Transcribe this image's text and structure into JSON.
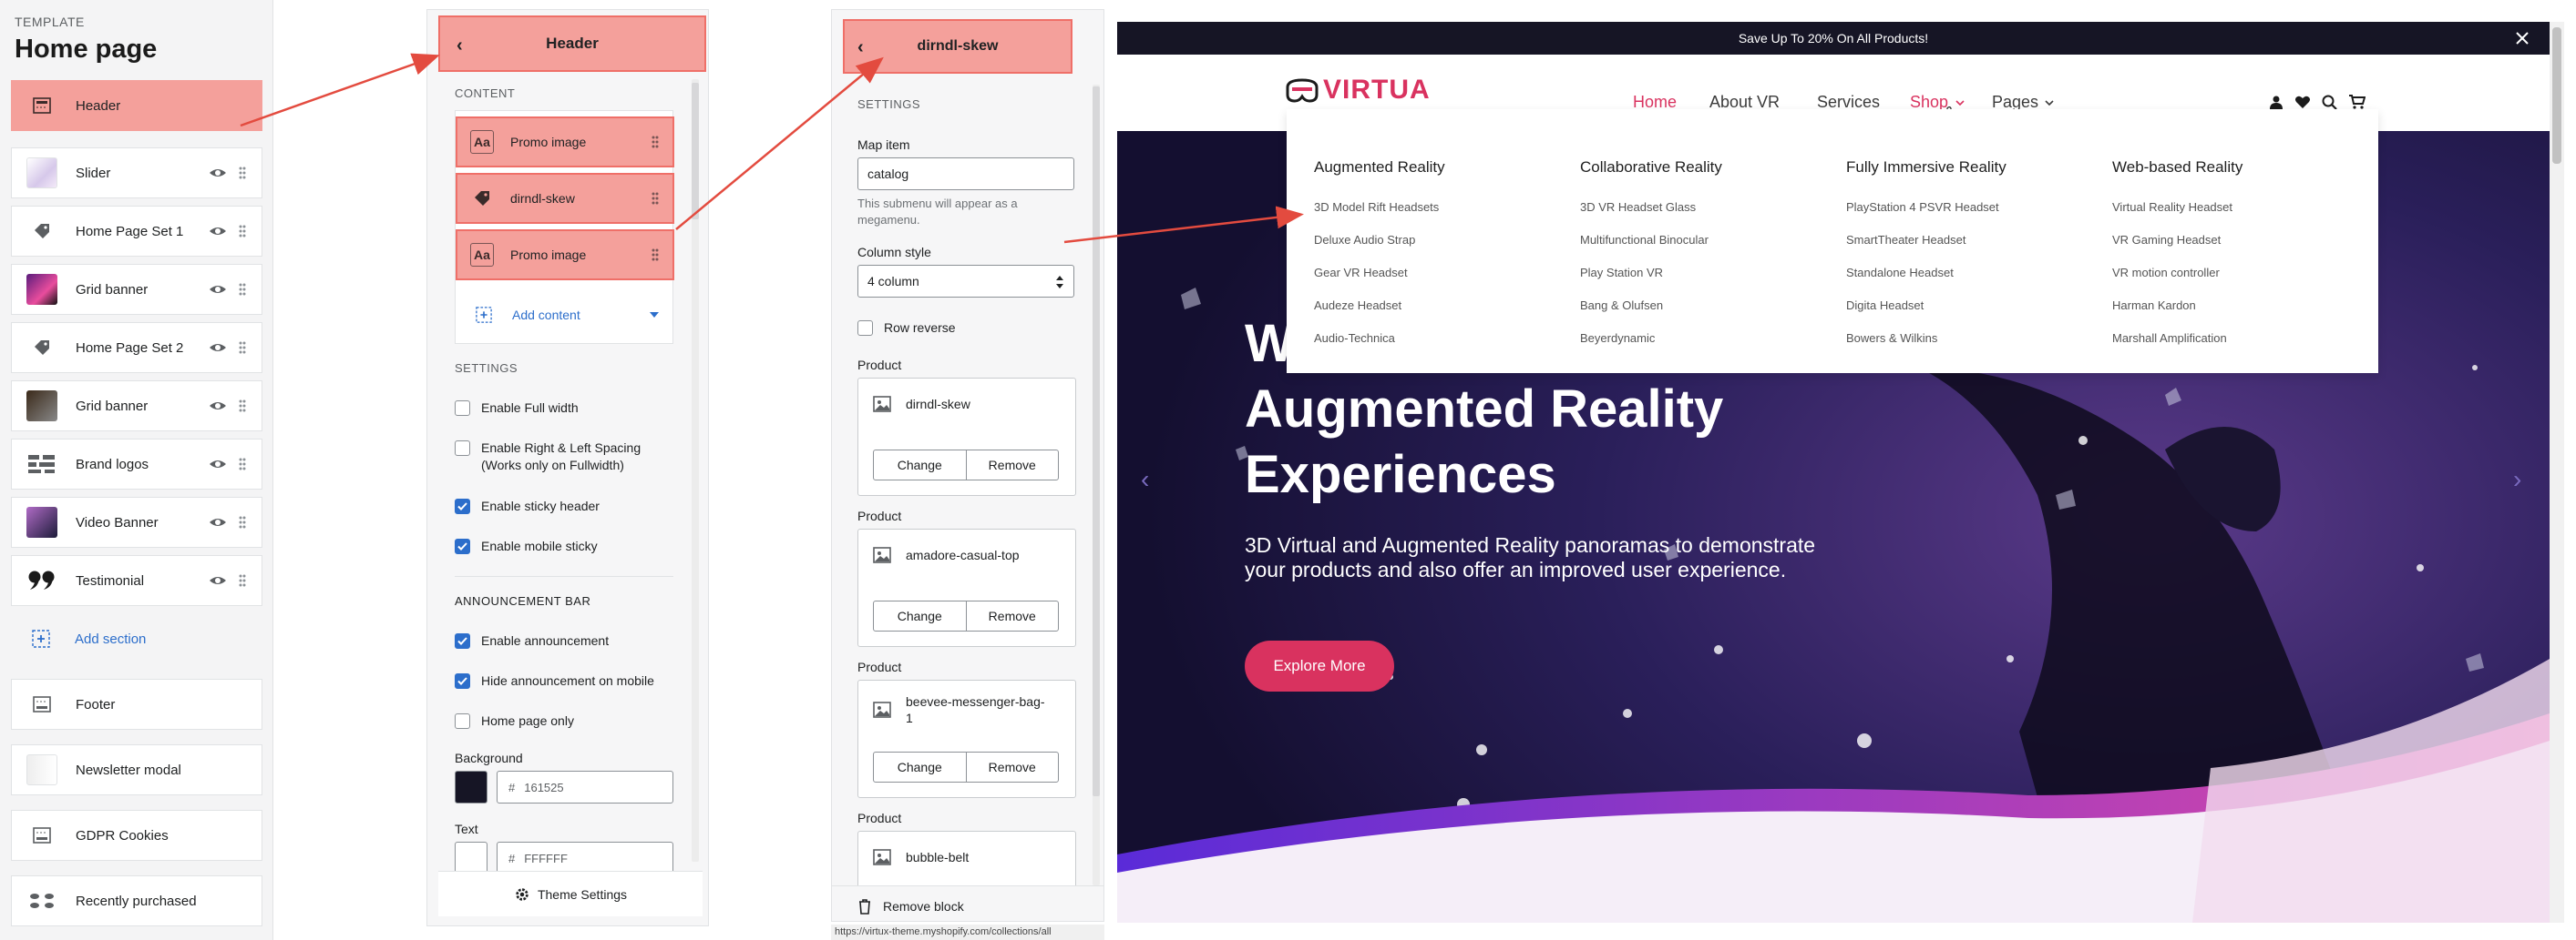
{
  "template_panel": {
    "kicker": "TEMPLATE",
    "title": "Home page",
    "sections": [
      {
        "label": "Header",
        "icon": "header-layout-icon"
      },
      {
        "label": "Slider",
        "icon": "slider-thumbnail"
      },
      {
        "label": "Home Page Set 1",
        "icon": "tag-icon"
      },
      {
        "label": "Grid banner",
        "icon": "grid-banner-thumbnail"
      },
      {
        "label": "Home Page Set 2",
        "icon": "tag-icon"
      },
      {
        "label": "Grid banner",
        "icon": "grid-banner-thumbnail"
      },
      {
        "label": "Brand logos",
        "icon": "brand-logos-thumbnail"
      },
      {
        "label": "Video Banner",
        "icon": "video-banner-thumbnail"
      },
      {
        "label": "Testimonial",
        "icon": "quote-icon"
      },
      {
        "label": "Add section",
        "icon": "add-section-icon"
      },
      {
        "label": "Footer",
        "icon": "footer-layout-icon"
      },
      {
        "label": "Newsletter modal",
        "icon": "newsletter-thumbnail"
      },
      {
        "label": "GDPR Cookies",
        "icon": "footer-layout-icon"
      },
      {
        "label": "Recently purchased",
        "icon": "products-thumbnail"
      }
    ]
  },
  "header_panel": {
    "title": "Header",
    "content_label": "CONTENT",
    "blocks": [
      {
        "label": "Promo image",
        "icon": "text-block-icon"
      },
      {
        "label": "dirndl-skew",
        "icon": "tag-icon"
      },
      {
        "label": "Promo image",
        "icon": "text-block-icon"
      }
    ],
    "add_content": "Add content",
    "settings_label": "SETTINGS",
    "settings": [
      {
        "label": "Enable Full width",
        "checked": false
      },
      {
        "label": "Enable Right & Left Spacing (Works only on Fullwidth)",
        "checked": false
      },
      {
        "label": "Enable sticky header",
        "checked": true
      },
      {
        "label": "Enable mobile sticky",
        "checked": true
      }
    ],
    "announcement_label": "ANNOUNCEMENT BAR",
    "announcement": [
      {
        "label": "Enable announcement",
        "checked": true
      },
      {
        "label": "Hide announcement on mobile",
        "checked": true
      },
      {
        "label": "Home page only",
        "checked": false
      }
    ],
    "background_label": "Background",
    "background_hex": "161525",
    "background_color": "#161525",
    "text_label": "Text",
    "text_hex": "FFFFFF",
    "text_color": "#FFFFFF",
    "theme_settings": "Theme Settings"
  },
  "block_panel": {
    "title": "dirndl-skew",
    "settings_label": "SETTINGS",
    "map_item_label": "Map item",
    "map_item_value": "catalog",
    "map_item_hint": "This submenu will appear as a megamenu.",
    "column_style_label": "Column style",
    "column_style_value": "4 column",
    "row_reverse": "Row reverse",
    "product_label": "Product",
    "products": [
      "dirndl-skew",
      "amadore-casual-top",
      "beevee-messenger-bag-1",
      "bubble-belt"
    ],
    "change": "Change",
    "remove": "Remove",
    "remove_block": "Remove block",
    "status_url": "https://virtux-theme.myshopify.com/collections/all"
  },
  "preview": {
    "announcement": "Save Up To 20% On All Products!",
    "logo": "VIRTUA",
    "nav": [
      "Home",
      "About VR",
      "Services",
      "Shop",
      "Pages"
    ],
    "megamenu": [
      {
        "title": "Augmented Reality",
        "items": [
          "3D Model Rift Headsets",
          "Deluxe Audio Strap",
          "Gear VR Headset",
          "Audeze Headset",
          "Audio-Technica"
        ]
      },
      {
        "title": "Collaborative Reality",
        "items": [
          "3D VR Headset Glass",
          "Multifunctional Binocular",
          "Play Station VR",
          "Bang & Olufsen",
          "Beyerdynamic"
        ]
      },
      {
        "title": "Fully Immersive Reality",
        "items": [
          "PlayStation 4 PSVR Headset",
          "SmartTheater Headset",
          "Standalone Headset",
          "Digita Headset",
          "Bowers & Wilkins"
        ]
      },
      {
        "title": "Web-based Reality",
        "items": [
          "Virtual Reality Headset",
          "VR Gaming Headset",
          "VR motion controller",
          "Harman Kardon",
          "Marshall Amplification"
        ]
      }
    ],
    "hero_line1": "W",
    "hero_line2": "Augmented Reality",
    "hero_line3": "Experiences",
    "hero_text": "3D Virtual and Augmented Reality panoramas to demonstrate your products and also offer an improved user experience.",
    "hero_button": "Explore More",
    "accent_color": "#d9325f",
    "nav_active_color": "#d9325f"
  }
}
